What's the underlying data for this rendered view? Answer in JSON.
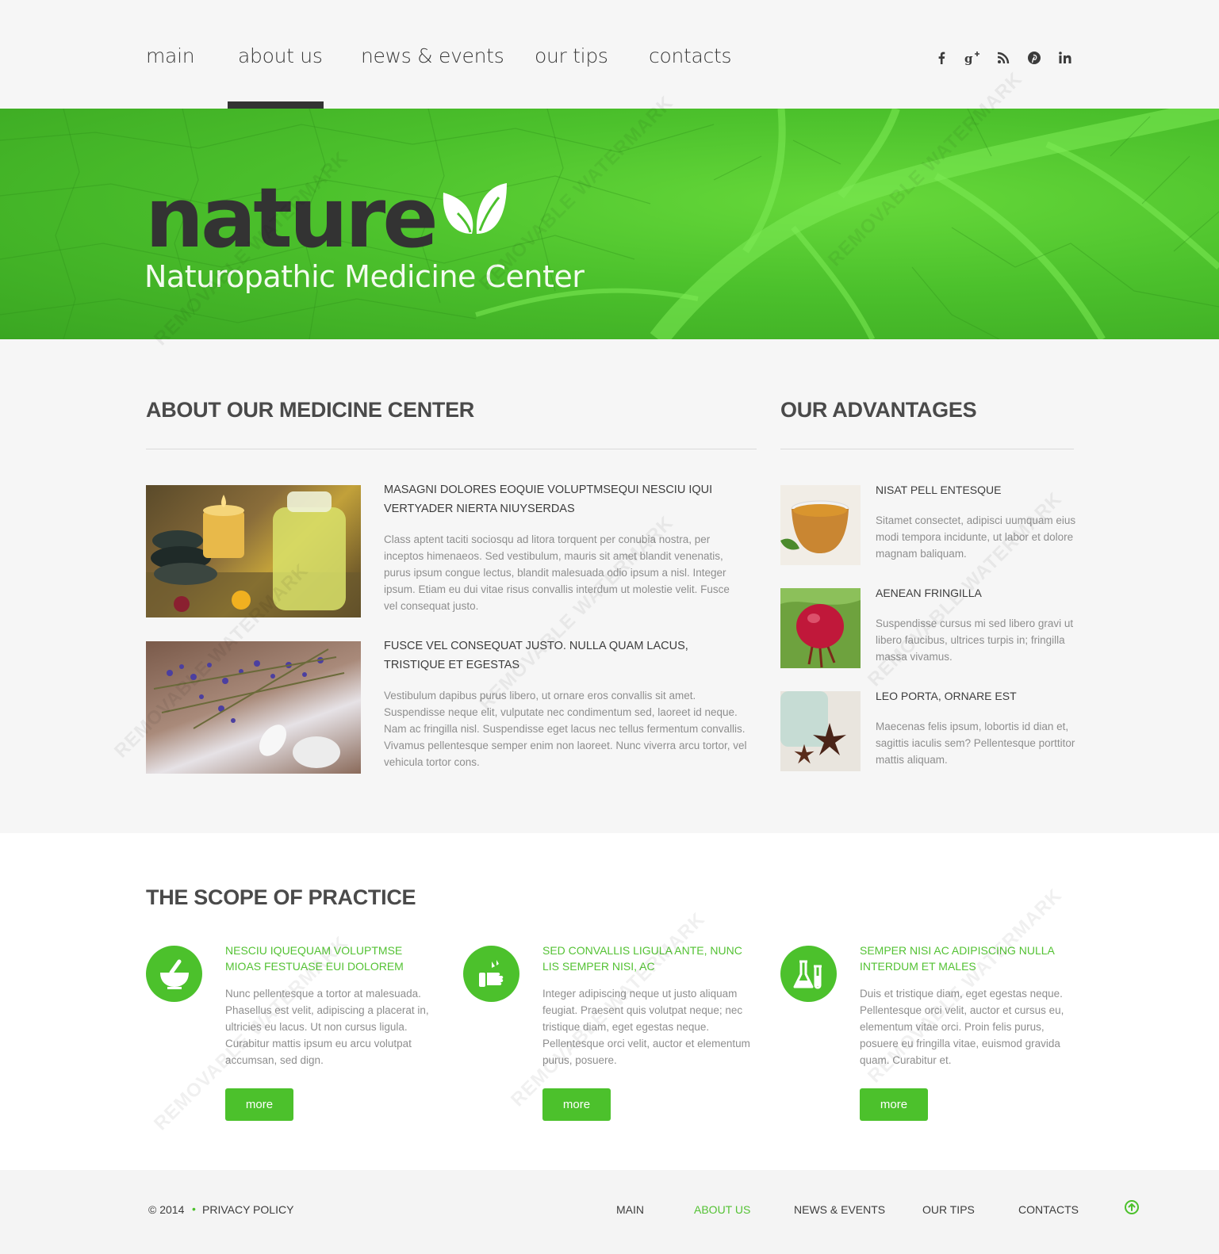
{
  "nav": {
    "items": [
      "main",
      "about us",
      "news & events",
      "our tips",
      "contacts"
    ],
    "active": "about us"
  },
  "social": [
    "facebook-icon",
    "google-plus-icon",
    "rss-icon",
    "pinterest-icon",
    "linkedin-icon"
  ],
  "hero": {
    "logo": "nature",
    "subtitle": "Naturopathic Medicine Center"
  },
  "about": {
    "title": "ABOUT OUR MEDICINE CENTER",
    "items": [
      {
        "heading": "MASAGNI DOLORES EOQUIE VOLUPTMSEQUI NESCIU IQUI VERTYADER NIERTA NIUYSERDAS",
        "text": "Class aptent taciti sociosqu ad litora torquent per conubia nostra, per inceptos himenaeos. Sed vestibulum, mauris sit amet blandit venenatis, purus ipsum congue lectus, blandit malesuada odio ipsum a nisl. Integer ipsum. Etiam eu dui vitae risus convallis interdum ut molestie velit. Fusce vel consequat justo."
      },
      {
        "heading": "FUSCE VEL CONSEQUAT JUSTO. NULLA QUAM LACUS, TRISTIQUE ET EGESTAS",
        "text": "Vestibulum dapibus purus libero, ut ornare eros convallis sit amet. Suspendisse neque elit, vulputate nec condimentum sed, laoreet id neque. Nam ac fringilla nisl. Suspendisse eget lacus nec tellus fermentum convallis. Vivamus pellentesque semper enim non laoreet. Nunc viverra arcu tortor, vel vehicula tortor cons."
      }
    ]
  },
  "advantages": {
    "title": "OUR ADVANTAGES",
    "items": [
      {
        "heading": "NISAT PELL ENTESQUE",
        "text": "Sitamet consectet, adipisci uumquam eius modi tempora incidunte, ut labor et dolore magnam baliquam."
      },
      {
        "heading": "AENEAN FRINGILLA",
        "text": "Suspendisse cursus mi sed libero gravi ut libero faucibus, ultrices turpis in; fringilla massa vivamus."
      },
      {
        "heading": "LEO PORTA, ORNARE EST",
        "text": "Maecenas felis ipsum, lobortis id dian et, sagittis iaculis sem? Pellentesque porttitor mattis aliquam."
      }
    ]
  },
  "scope": {
    "title": "THE SCOPE OF PRACTICE",
    "items": [
      {
        "icon": "mortar-pestle-icon",
        "heading": "NESCIU IQUEQUAM VOLUPTMSE MIOAS FESTUASE EUI DOLOREM",
        "text": "Nunc pellentesque a tortor at malesuada. Phasellus est velit, adipiscing a placerat in, ultricies eu lacus. Ut non cursus ligula. Curabitur mattis ipsum eu arcu volutpat accumsan, sed dign.",
        "button": "more"
      },
      {
        "icon": "hand-icon",
        "heading": "SED CONVALLIS LIGULA ANTE, NUNC LIS SEMPER NISI, AC",
        "text": "Integer adipiscing neque ut justo aliquam feugiat. Praesent quis volutpat neque; nec tristique diam, eget egestas neque. Pellentesque orci velit, auctor et elementum purus, posuere.",
        "button": "more"
      },
      {
        "icon": "lab-flasks-icon",
        "heading": "SEMPER NISI AC ADIPISCING NULLA INTERDUM ET MALES",
        "text": "Duis et tristique diam, eget egestas neque. Pellentesque orci velit, auctor et cursus eu, elementum vitae orci. Proin felis purus, posuere eu fringilla vitae, euismod gravida quam. Curabitur et.",
        "button": "more"
      }
    ]
  },
  "footer": {
    "copyright": "© 2014",
    "privacy": "PRIVACY POLICY",
    "links": [
      "MAIN",
      "ABOUT US",
      "NEWS & EVENTS",
      "OUR TIPS",
      "CONTACTS"
    ],
    "active": "ABOUT US"
  },
  "watermark": "REMOVABLE WATERMARK",
  "colors": {
    "accent": "#4cc12c",
    "accent_text": "#54c234",
    "dark": "#333333"
  }
}
